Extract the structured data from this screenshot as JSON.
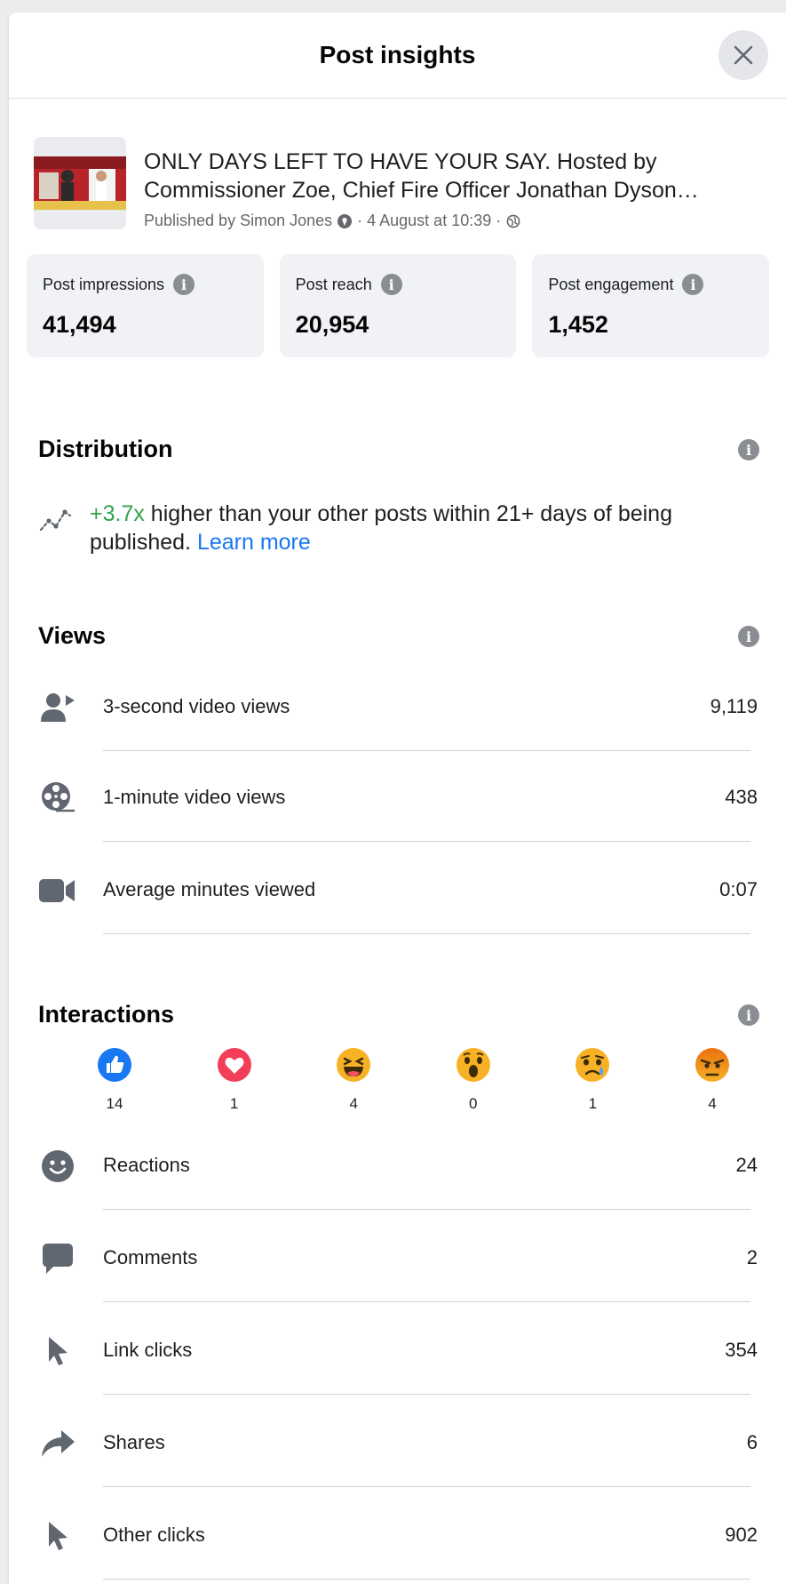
{
  "header": {
    "title": "Post insights"
  },
  "post": {
    "text": "ONLY DAYS LEFT TO HAVE YOUR SAY. Hosted by Commissioner Zoe, Chief Fire Officer Jonathan Dyson…",
    "meta_prefix": "Published by Simon Jones",
    "meta_date": "· 4 August at 10:39 ·"
  },
  "stats": [
    {
      "label": "Post impressions",
      "value": "41,494"
    },
    {
      "label": "Post reach",
      "value": "20,954"
    },
    {
      "label": "Post engagement",
      "value": "1,452"
    }
  ],
  "distribution": {
    "title": "Distribution",
    "highlight": "+3.7x",
    "text": " higher than your other posts within 21+ days of being published. ",
    "link": "Learn more"
  },
  "views": {
    "title": "Views",
    "rows": [
      {
        "label": "3-second video views",
        "value": "9,119",
        "icon": "person-play-icon"
      },
      {
        "label": "1-minute video views",
        "value": "438",
        "icon": "film-reel-icon"
      },
      {
        "label": "Average minutes viewed",
        "value": "0:07",
        "icon": "video-camera-icon"
      }
    ]
  },
  "interactions": {
    "title": "Interactions",
    "reactions": [
      {
        "name": "like-reaction-icon",
        "count": "14"
      },
      {
        "name": "love-reaction-icon",
        "count": "1"
      },
      {
        "name": "haha-reaction-icon",
        "count": "4"
      },
      {
        "name": "wow-reaction-icon",
        "count": "0"
      },
      {
        "name": "sad-reaction-icon",
        "count": "1"
      },
      {
        "name": "angry-reaction-icon",
        "count": "4"
      }
    ],
    "rows": [
      {
        "label": "Reactions",
        "value": "24",
        "icon": "smiley-icon"
      },
      {
        "label": "Comments",
        "value": "2",
        "icon": "comment-bubble-icon"
      },
      {
        "label": "Link clicks",
        "value": "354",
        "icon": "cursor-icon"
      },
      {
        "label": "Shares",
        "value": "6",
        "icon": "share-arrow-icon"
      },
      {
        "label": "Other clicks",
        "value": "902",
        "icon": "cursor-icon"
      }
    ]
  },
  "colors": {
    "accent_link": "#1877f2",
    "positive_green": "#31a24c",
    "icon_gray": "#606770",
    "card_bg": "#f0f2f5"
  }
}
